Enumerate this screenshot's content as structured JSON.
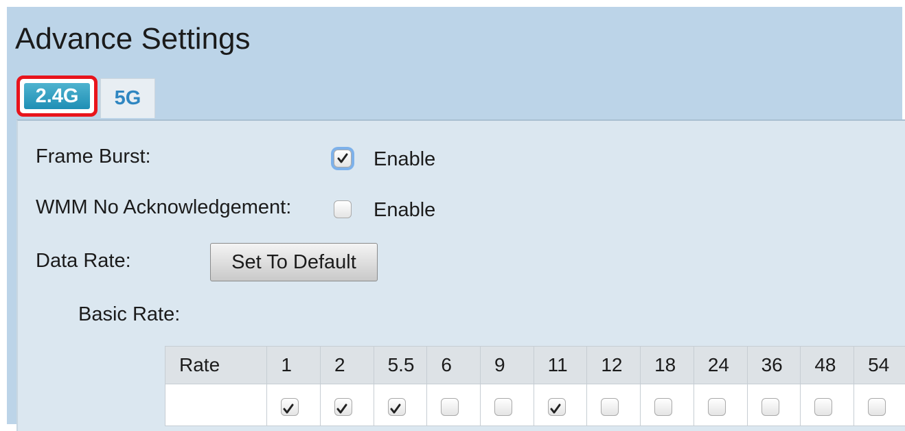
{
  "page": {
    "title": "Advance Settings"
  },
  "tabs": [
    {
      "label": "2.4G",
      "active": true
    },
    {
      "label": "5G",
      "active": false
    }
  ],
  "settings": {
    "frame_burst": {
      "label": "Frame Burst:",
      "checkbox_label": "Enable",
      "checked": true
    },
    "wmm_no_ack": {
      "label": "WMM No Acknowledgement:",
      "checkbox_label": "Enable",
      "checked": false
    },
    "data_rate": {
      "label": "Data Rate:",
      "button_label": "Set To Default"
    },
    "basic_rate": {
      "label": "Basic Rate:"
    }
  },
  "rate_table": {
    "header_label": "Rate",
    "rates": [
      {
        "value": "1",
        "checked": true
      },
      {
        "value": "2",
        "checked": true
      },
      {
        "value": "5.5",
        "checked": true
      },
      {
        "value": "6",
        "checked": false
      },
      {
        "value": "9",
        "checked": false
      },
      {
        "value": "11",
        "checked": true
      },
      {
        "value": "12",
        "checked": false
      },
      {
        "value": "18",
        "checked": false
      },
      {
        "value": "24",
        "checked": false
      },
      {
        "value": "36",
        "checked": false
      },
      {
        "value": "48",
        "checked": false
      },
      {
        "value": "54",
        "checked": false
      }
    ]
  },
  "colors": {
    "page_background": "#bcd4e8",
    "panel_background": "#dbe7f0",
    "active_tab": "#1f8fb5",
    "inactive_tab_text": "#2f86c1",
    "highlight_outline": "#e8141c"
  }
}
